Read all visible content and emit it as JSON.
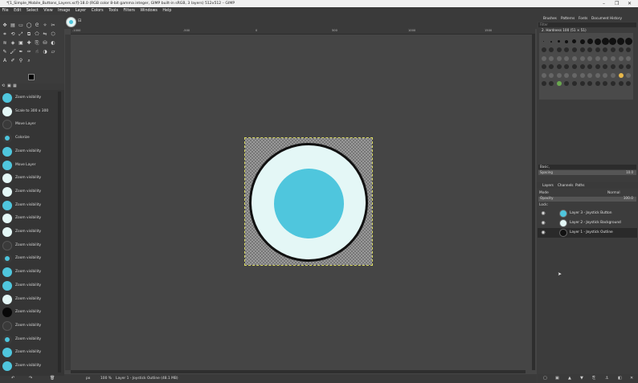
{
  "window": {
    "title": "*[1_Simple_Mobile_Buttons_Layers.xcf]-18.0 (RGB color 8-bit gamma integer, GIMP built-in sRGB, 3 layers) 512x512 – GIMP",
    "controls": [
      "–",
      "❐",
      "✕"
    ]
  },
  "menu": [
    "File",
    "Edit",
    "Select",
    "View",
    "Image",
    "Layer",
    "Colors",
    "Tools",
    "Filters",
    "Windows",
    "Help"
  ],
  "undo_history": [
    {
      "label": "Zoom visibility",
      "thumb": "disc"
    },
    {
      "label": "Scale to 300 x 300",
      "thumb": "disc-light"
    },
    {
      "label": "Move Layer",
      "thumb": "dark"
    },
    {
      "label": "Colorize",
      "thumb": "dot"
    },
    {
      "label": "Zoom visibility",
      "thumb": "disc"
    },
    {
      "label": "Move Layer",
      "thumb": "disc"
    },
    {
      "label": "Zoom visibility",
      "thumb": "disc-light"
    },
    {
      "label": "Zoom visibility",
      "thumb": "disc-light"
    },
    {
      "label": "Zoom visibility",
      "thumb": "disc"
    },
    {
      "label": "Zoom visibility",
      "thumb": "disc-light"
    },
    {
      "label": "Zoom visibility",
      "thumb": "disc-light"
    },
    {
      "label": "Zoom visibility",
      "thumb": "dark"
    },
    {
      "label": "Zoom visibility",
      "thumb": "dot"
    },
    {
      "label": "Zoom visibility",
      "thumb": "disc"
    },
    {
      "label": "Zoom visibility",
      "thumb": "disc"
    },
    {
      "label": "Zoom visibility",
      "thumb": "disc-light"
    },
    {
      "label": "Zoom visibility",
      "thumb": "black"
    },
    {
      "label": "Zoom visibility",
      "thumb": "dark"
    },
    {
      "label": "Zoom visibility",
      "thumb": "dot"
    },
    {
      "label": "Zoom visibility",
      "thumb": "disc"
    },
    {
      "label": "Zoom visibility",
      "thumb": "disc"
    }
  ],
  "ruler": {
    "labels": [
      "-1000",
      "-500",
      "0",
      "500",
      "1000",
      "1500"
    ]
  },
  "status": {
    "unit": "px",
    "zoom": "100 %",
    "message": "Layer 1 - Joystick Outline (48.1 MB)"
  },
  "dock": {
    "top_tabs": [
      "Brushes",
      "Patterns",
      "Fonts",
      "Document History"
    ],
    "filter_placeholder": "Filter",
    "brush_name": "2. Hardness 100 (51 × 51)",
    "brush_tag": "Basic,",
    "spacing_label": "Spacing",
    "spacing_value": "10.0",
    "layer_tabs": [
      "Layers",
      "Channels",
      "Paths"
    ],
    "mode_label": "Mode",
    "mode_value": "Normal",
    "opacity_label": "Opacity",
    "opacity_value": "100.0",
    "lock_label": "Lock:"
  },
  "layers": [
    {
      "name": "Layer 3 - Joystick Button",
      "thumb": "dot"
    },
    {
      "name": "Layer 2 - Joystick Background",
      "thumb": "disc-light"
    },
    {
      "name": "Layer 1 - Joystick Outline",
      "thumb": "black"
    }
  ],
  "colors": {
    "accent_cyan": "#4fc6dd",
    "disc_light": "#e4f7f6",
    "outline": "#111111"
  }
}
